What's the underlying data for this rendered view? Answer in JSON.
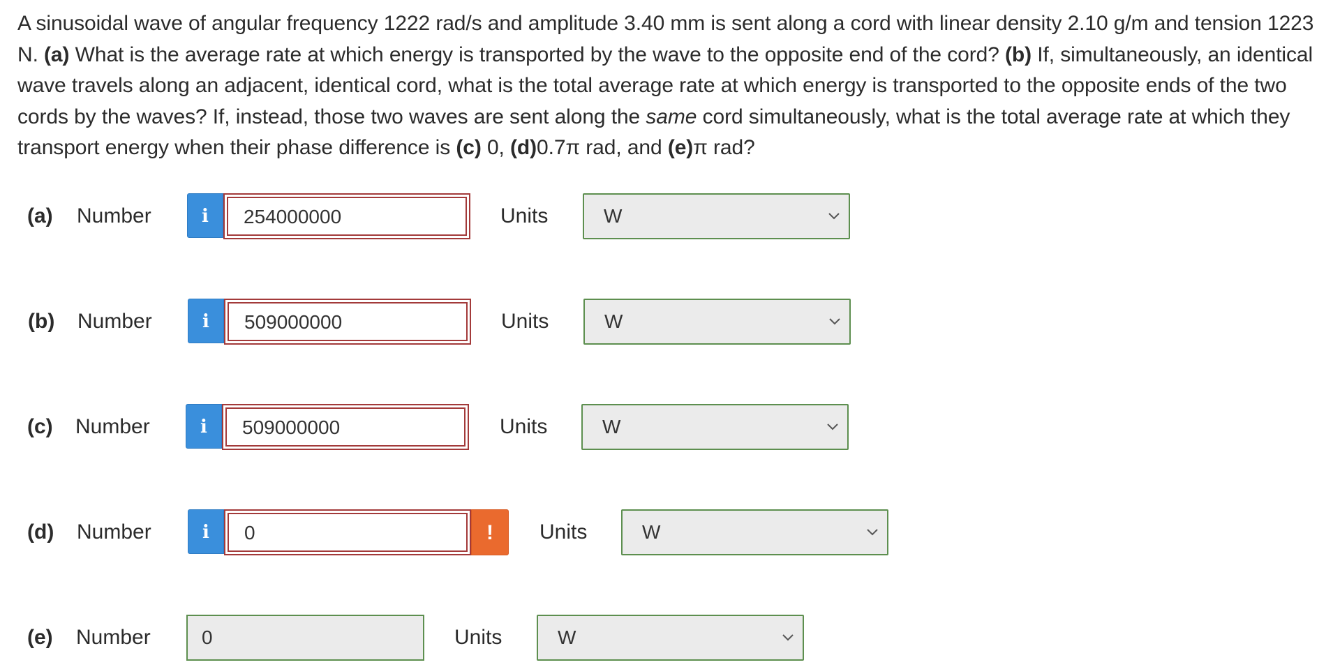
{
  "question": {
    "s1": "A sinusoidal wave of angular frequency 1222 rad/s and amplitude 3.40 mm is sent along a cord with linear density 2.10 g/m and tension 1223 N. ",
    "a_tag": "(a)",
    "s2": " What is the average rate at which energy is transported by the wave to the opposite end of the cord? ",
    "b_tag": "(b)",
    "s3": " If, simultaneously, an identical wave travels along an adjacent, identical cord, what is the total average rate at which energy is transported to the opposite ends of the two cords by the waves? If, instead, those two waves are sent along the ",
    "same": "same",
    "s4": " cord simultaneously, what is the total average rate at which they transport energy when their phase difference is ",
    "c_tag": "(c)",
    "s5": " 0, ",
    "d_tag": "(d)",
    "s6": "0.7π rad, and ",
    "e_tag": "(e)",
    "s7": "π rad?"
  },
  "parts": [
    {
      "label": "(a)",
      "number_label": "Number",
      "value": "254000000",
      "units_label": "Units",
      "unit": "W"
    },
    {
      "label": "(b)",
      "number_label": "Number",
      "value": "509000000",
      "units_label": "Units",
      "unit": "W"
    },
    {
      "label": "(c)",
      "number_label": "Number",
      "value": "509000000",
      "units_label": "Units",
      "unit": "W"
    },
    {
      "label": "(d)",
      "number_label": "Number",
      "value": "0",
      "units_label": "Units",
      "unit": "W",
      "warning": "!"
    },
    {
      "label": "(e)",
      "number_label": "Number",
      "value": "0",
      "units_label": "Units",
      "unit": "W"
    }
  ],
  "info_icon_glyph": "i",
  "colors": {
    "info": "#3a8fdc",
    "warning": "#ea6a2e",
    "incorrect_border": "#a33a3a",
    "select_border": "#5d8f4f"
  }
}
